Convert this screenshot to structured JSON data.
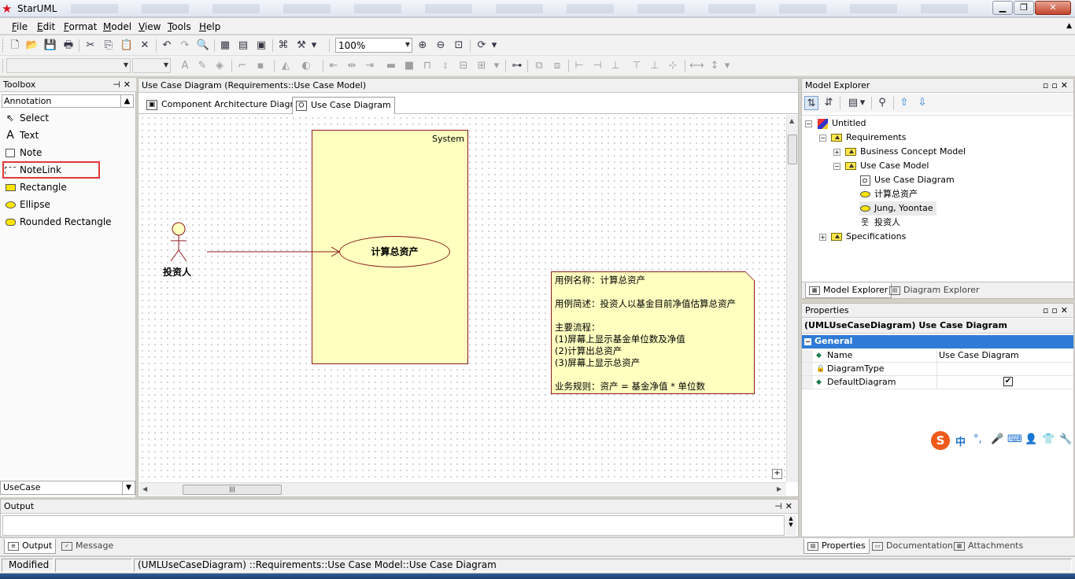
{
  "window": {
    "title": "StarUML",
    "min_symbol": "▁",
    "max_symbol": "❐",
    "close_symbol": "✕"
  },
  "menu": [
    "File",
    "Edit",
    "Format",
    "Model",
    "View",
    "Tools",
    "Help"
  ],
  "menu_accel": [
    "F",
    "E",
    "F",
    "M",
    "V",
    "T",
    "H"
  ],
  "toolbar": {
    "zoom_value": "100%"
  },
  "toolbox": {
    "title": "Toolbox",
    "group": "Annotation",
    "items": [
      "Select",
      "Text",
      "Note",
      "NoteLink",
      "Rectangle",
      "Ellipse",
      "Rounded Rectangle"
    ],
    "bottom_group": "UseCase"
  },
  "diagram": {
    "header": "Use Case Diagram (Requirements::Use Case Model)",
    "tabs": [
      "Component Architecture Diagram",
      "Use Case Diagram"
    ],
    "system_label": "System",
    "usecase_label": "计算总资产",
    "actor_label": "投资人",
    "note_lines": [
      "用例名称：计算总资产",
      "",
      "用例简述：投资人以基金目前净值估算总资产",
      "",
      "主要流程：",
      "(1)屏幕上显示基金单位数及净值",
      "(2)计算出总资产",
      "(3)屏幕上显示总资产",
      "",
      "业务规则：资产 = 基金净值 * 单位数"
    ]
  },
  "model_explorer": {
    "title": "Model Explorer",
    "tree": [
      {
        "label": "Untitled"
      },
      {
        "label": "Requirements"
      },
      {
        "label": "Business Concept Model"
      },
      {
        "label": "Use Case Model"
      },
      {
        "label": "Use Case Diagram"
      },
      {
        "label": "计算总资产"
      },
      {
        "label": "Jung, Yoontae"
      },
      {
        "label": "投资人"
      },
      {
        "label": "Specifications"
      }
    ],
    "tabs": [
      "Model Explorer",
      "Diagram Explorer"
    ]
  },
  "properties": {
    "title": "Properties",
    "subject": "(UMLUseCaseDiagram) Use Case Diagram",
    "group": "General",
    "rows": [
      {
        "name": "Name",
        "value": "Use Case Diagram"
      },
      {
        "name": "DiagramType",
        "value": ""
      },
      {
        "name": "DefaultDiagram",
        "value": "✔"
      }
    ],
    "tabs": [
      "Properties",
      "Documentation",
      "Attachments"
    ]
  },
  "ime": {
    "logo": "S",
    "items": [
      "中",
      "°,",
      "🎤",
      "⌨",
      "👤",
      "👕",
      "🔧"
    ]
  },
  "output": {
    "title": "Output",
    "tabs": [
      "Output",
      "Message"
    ]
  },
  "status": {
    "state": "Modified",
    "path": "(UMLUseCaseDiagram) ::Requirements::Use Case Model::Use Case Diagram"
  },
  "colors": {
    "note_fill": "#ffffc0",
    "border_dark_red": "#8b1a1a",
    "selection_blue": "#2f7bd6",
    "highlight_red": "#e03a3a"
  }
}
